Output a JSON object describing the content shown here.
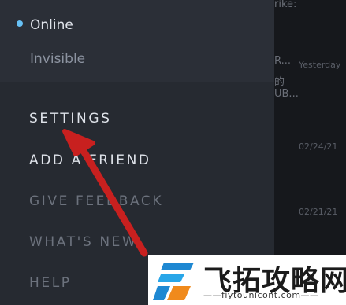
{
  "status_menu": {
    "online_label": "Online",
    "invisible_label": "Invisible"
  },
  "menu": {
    "settings": "SETTINGS",
    "add_friend": "ADD A FRIEND",
    "give_feedback": "GIVE FEEDBACK",
    "whats_new": "WHAT'S NEW",
    "help": "HELP"
  },
  "background_chat": {
    "line_top": "rike:",
    "line_r": "R...",
    "yesterday": "Yesterday",
    "line_de": "的",
    "line_ub": "UB...",
    "date1": "02/24/21",
    "date2": "02/21/21"
  },
  "watermark": {
    "title": "飞拓攻略网",
    "url": "——fiytounicont.com——"
  },
  "colors": {
    "online_dot": "#67c1f5",
    "arrow": "#c8201f"
  }
}
